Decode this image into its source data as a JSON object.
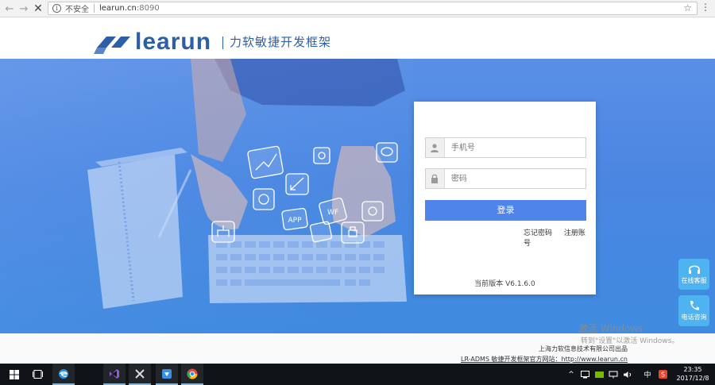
{
  "browser": {
    "security_label": "不安全",
    "url_host": "learun.cn",
    "url_port": ":8090"
  },
  "header": {
    "logo_text": "learun",
    "slogan": "力软敏捷开发框架"
  },
  "hero": {
    "tile_labels": [
      "APP",
      "WF"
    ]
  },
  "login": {
    "phone_placeholder": "手机号",
    "password_placeholder": "密码",
    "login_button": "登录",
    "forgot_password": "忘记密码",
    "register": "注册账号",
    "version": "当前版本 V6.1.6.0"
  },
  "float": {
    "online_service": "在线客服",
    "phone_consult": "电话咨询"
  },
  "footer": {
    "company": "上海力软信息技术有限公司出品",
    "site": "LR-ADMS 敏捷开发框架官方网站：http://www.learun.cn"
  },
  "watermark": {
    "line1": "激活 Windows",
    "line2": "转到\"设置\"以激活 Windows。"
  },
  "taskbar": {
    "time": "23:35",
    "date": "2017/12/8",
    "ime": "中"
  },
  "colors": {
    "brand": "#2c5fa8",
    "button": "#4f84ea",
    "float_button": "#4fb3f2",
    "hero": "#4a86e2"
  }
}
